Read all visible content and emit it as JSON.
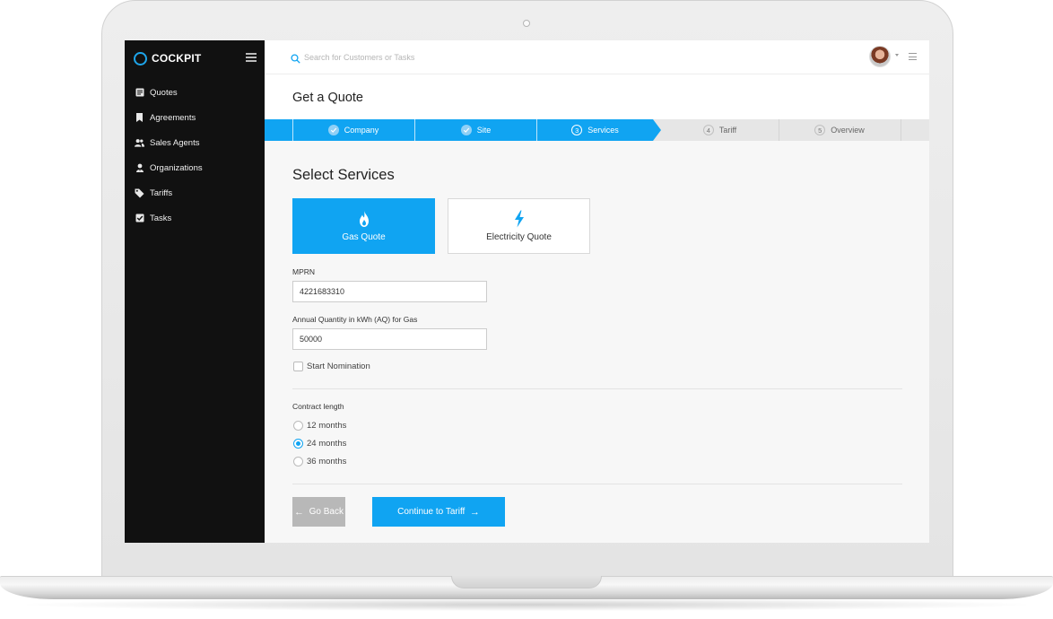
{
  "brand": {
    "name": "COCKPIT",
    "accent": "#1ea5ea"
  },
  "sidebar": {
    "items": [
      {
        "label": "Quotes",
        "icon": "document-icon"
      },
      {
        "label": "Agreements",
        "icon": "bookmark-icon"
      },
      {
        "label": "Sales Agents",
        "icon": "users-icon"
      },
      {
        "label": "Organizations",
        "icon": "organization-icon"
      },
      {
        "label": "Tariffs",
        "icon": "tag-icon"
      },
      {
        "label": "Tasks",
        "icon": "checkbox-icon"
      }
    ]
  },
  "topbar": {
    "search_placeholder": "Search for Customers or Tasks"
  },
  "page": {
    "title": "Get a Quote"
  },
  "stepper": {
    "steps": [
      {
        "number": "1",
        "label": "Company",
        "state": "done"
      },
      {
        "number": "2",
        "label": "Site",
        "state": "done"
      },
      {
        "number": "3",
        "label": "Services",
        "state": "active"
      },
      {
        "number": "4",
        "label": "Tariff",
        "state": "pending"
      },
      {
        "number": "5",
        "label": "Overview",
        "state": "pending"
      }
    ]
  },
  "services": {
    "title": "Select Services",
    "options": [
      {
        "label": "Gas Quote",
        "icon": "flame-icon",
        "selected": true
      },
      {
        "label": "Electricity Quote",
        "icon": "lightning-icon",
        "selected": false
      }
    ]
  },
  "form": {
    "mprn_label": "MPRN",
    "mprn_value": "4221683310",
    "aq_label": "Annual Quantity in kWh (AQ) for Gas",
    "aq_value": "50000",
    "nomination_label": "Start Nomination",
    "nomination_checked": false,
    "contract_label": "Contract length",
    "contract_options": [
      {
        "label": "12 months",
        "selected": false
      },
      {
        "label": "24 months",
        "selected": true
      },
      {
        "label": "36 months",
        "selected": false
      }
    ]
  },
  "actions": {
    "back_label": "Go Back",
    "continue_label": "Continue to Tariff"
  },
  "colors": {
    "primary": "#10a4f2",
    "sidebar": "#111111",
    "disabled": "#b8b8b8"
  }
}
